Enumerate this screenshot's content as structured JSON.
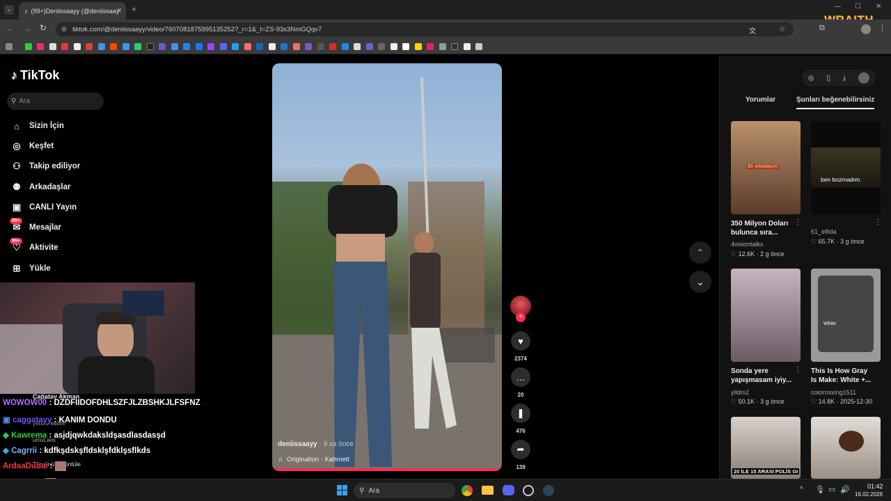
{
  "browser": {
    "tab_title": "(99+)Deniissaayy (@deniissaay",
    "url": "tiktok.com/@deniissaayy/video/7607081875995135252?_r=1&_t=ZS-93x3NmGQqv7",
    "overlay_logo": "WRAITH"
  },
  "sidebar": {
    "logo": "TikTok",
    "search_placeholder": "Ara",
    "items": [
      {
        "label": "Sizin İçin",
        "icon": "home-icon"
      },
      {
        "label": "Keşfet",
        "icon": "compass-icon"
      },
      {
        "label": "Takip ediliyor",
        "icon": "following-icon"
      },
      {
        "label": "Arkadaşlar",
        "icon": "friends-icon"
      },
      {
        "label": "CANLI Yayın",
        "icon": "live-icon"
      },
      {
        "label": "Mesajlar",
        "icon": "messages-icon",
        "badge": "99+"
      },
      {
        "label": "Aktivite",
        "icon": "activity-icon",
        "badge": "99+"
      },
      {
        "label": "Yükle",
        "icon": "upload-icon"
      }
    ]
  },
  "video": {
    "author": "deniissaayy",
    "time_ago": "· 9 sa önce",
    "sound": "Originalton - Kahmett",
    "likes": "2374",
    "comments": "20",
    "saves": "476",
    "shares": "139"
  },
  "right_panel": {
    "tab_comments": "Yorumlar",
    "tab_suggested": "Şunları beğenebilirsiniz",
    "cards": [
      {
        "title": "350 Milyon Doları bulunca sıra...",
        "author": "4visiontalks",
        "likes": "12.6K",
        "date": "2 g önce",
        "caption": "Bir arkadaşım"
      },
      {
        "title": "",
        "author": "61_elfida",
        "likes": "65.7K",
        "date": "3 g önce",
        "caption": "ben bozmadım."
      },
      {
        "title": "Sonda yere yapışmasam iyiy...",
        "author": "ylldm2",
        "likes": "50.1K",
        "date": "3 g önce",
        "caption": ""
      },
      {
        "title": "This Is How Gray Is Make: White +...",
        "author": "colormixing1511",
        "likes": "14.8K",
        "date": "2025-12-30",
        "caption": "White"
      },
      {
        "title": "",
        "author": "",
        "likes": "",
        "date": "",
        "caption": "20 İLE 15 ARASI POLİS GI"
      },
      {
        "title": "",
        "author": "",
        "likes": "",
        "date": "",
        "caption": ""
      }
    ]
  },
  "stream": {
    "chat": [
      {
        "user": "WOWOW00",
        "msg": "DZDFIIDOFDHLSZFJLZBSHKJLFSFNZ",
        "color": "#b36cff"
      },
      {
        "user": "caggatayy",
        "msg": "KANIM DONDU",
        "color": "#7a4dff"
      },
      {
        "user": "Kawrema",
        "msg": "asjdjqwkdaksldşasdlasdasşd",
        "color": "#33cc33"
      },
      {
        "user": "Cagrrii",
        "msg": "kdfkşdskşfldsklşfdklşsflkds",
        "color": "#7fb2ff"
      },
      {
        "user": "ArdaaDubai",
        "msg": "",
        "color": "#ff3344"
      },
      {
        "user": "balafor",
        "msg": "",
        "color": "#ff4466"
      }
    ],
    "underlay": {
      "user": "Çağatay Akman",
      "line1": "yeniltcreative",
      "line2": "umut.aes",
      "line3": "Tümünü görüntüle"
    }
  },
  "taskbar": {
    "search": "Ara",
    "time": "01:42",
    "date": "16.02.2026"
  }
}
